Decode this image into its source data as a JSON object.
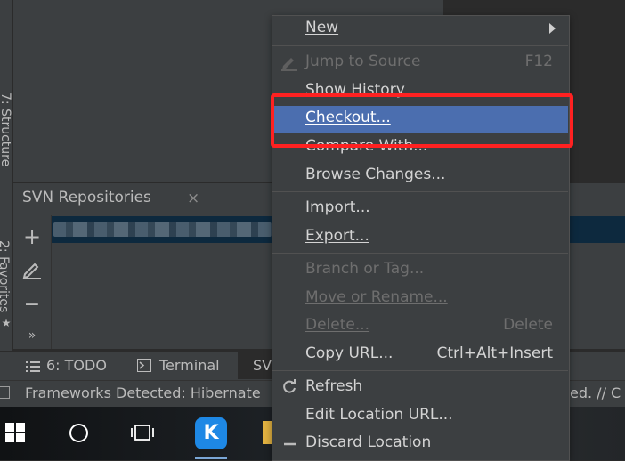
{
  "side_rail": {
    "structure_label": "7: Structure",
    "favorites_label": "2: Favorites"
  },
  "svn_panel": {
    "title": "SVN Repositories",
    "close_glyph": "×",
    "tools": [
      "+",
      "−",
      "»"
    ]
  },
  "bottom_tabs": {
    "todo": "6: TODO",
    "terminal": "Terminal",
    "svn": "SV"
  },
  "status_bar": {
    "text": "Frameworks Detected: Hibernate",
    "tail": "ed. // C"
  },
  "context_menu": {
    "items": [
      {
        "label": "New",
        "shortcut": "",
        "enabled": true,
        "submenu": true
      },
      {
        "label": "Jump to Source",
        "shortcut": "F12",
        "enabled": false
      },
      {
        "label": "Show History",
        "shortcut": "",
        "enabled": true
      },
      {
        "label": "Checkout...",
        "shortcut": "",
        "enabled": true,
        "selected": true
      },
      {
        "label": "Compare With...",
        "shortcut": "",
        "enabled": true
      },
      {
        "label": "Browse Changes...",
        "shortcut": "",
        "enabled": true
      },
      {
        "label": "Import...",
        "shortcut": "",
        "enabled": true
      },
      {
        "label": "Export...",
        "shortcut": "",
        "enabled": true
      },
      {
        "label": "Branch or Tag...",
        "shortcut": "",
        "enabled": false
      },
      {
        "label": "Move or Rename...",
        "shortcut": "",
        "enabled": false
      },
      {
        "label": "Delete...",
        "shortcut": "Delete",
        "enabled": false
      },
      {
        "label": "Copy URL...",
        "shortcut": "Ctrl+Alt+Insert",
        "enabled": true
      },
      {
        "label": "Refresh",
        "shortcut": "",
        "enabled": true
      },
      {
        "label": "Edit Location URL...",
        "shortcut": "",
        "enabled": true
      },
      {
        "label": "Discard Location",
        "shortcut": "",
        "enabled": true
      }
    ]
  },
  "taskbar": {
    "kugou_letter": "K"
  },
  "colors": {
    "selection": "#4b6eaf",
    "highlight_box": "#ff2121",
    "panel_bg": "#3c3f41"
  }
}
